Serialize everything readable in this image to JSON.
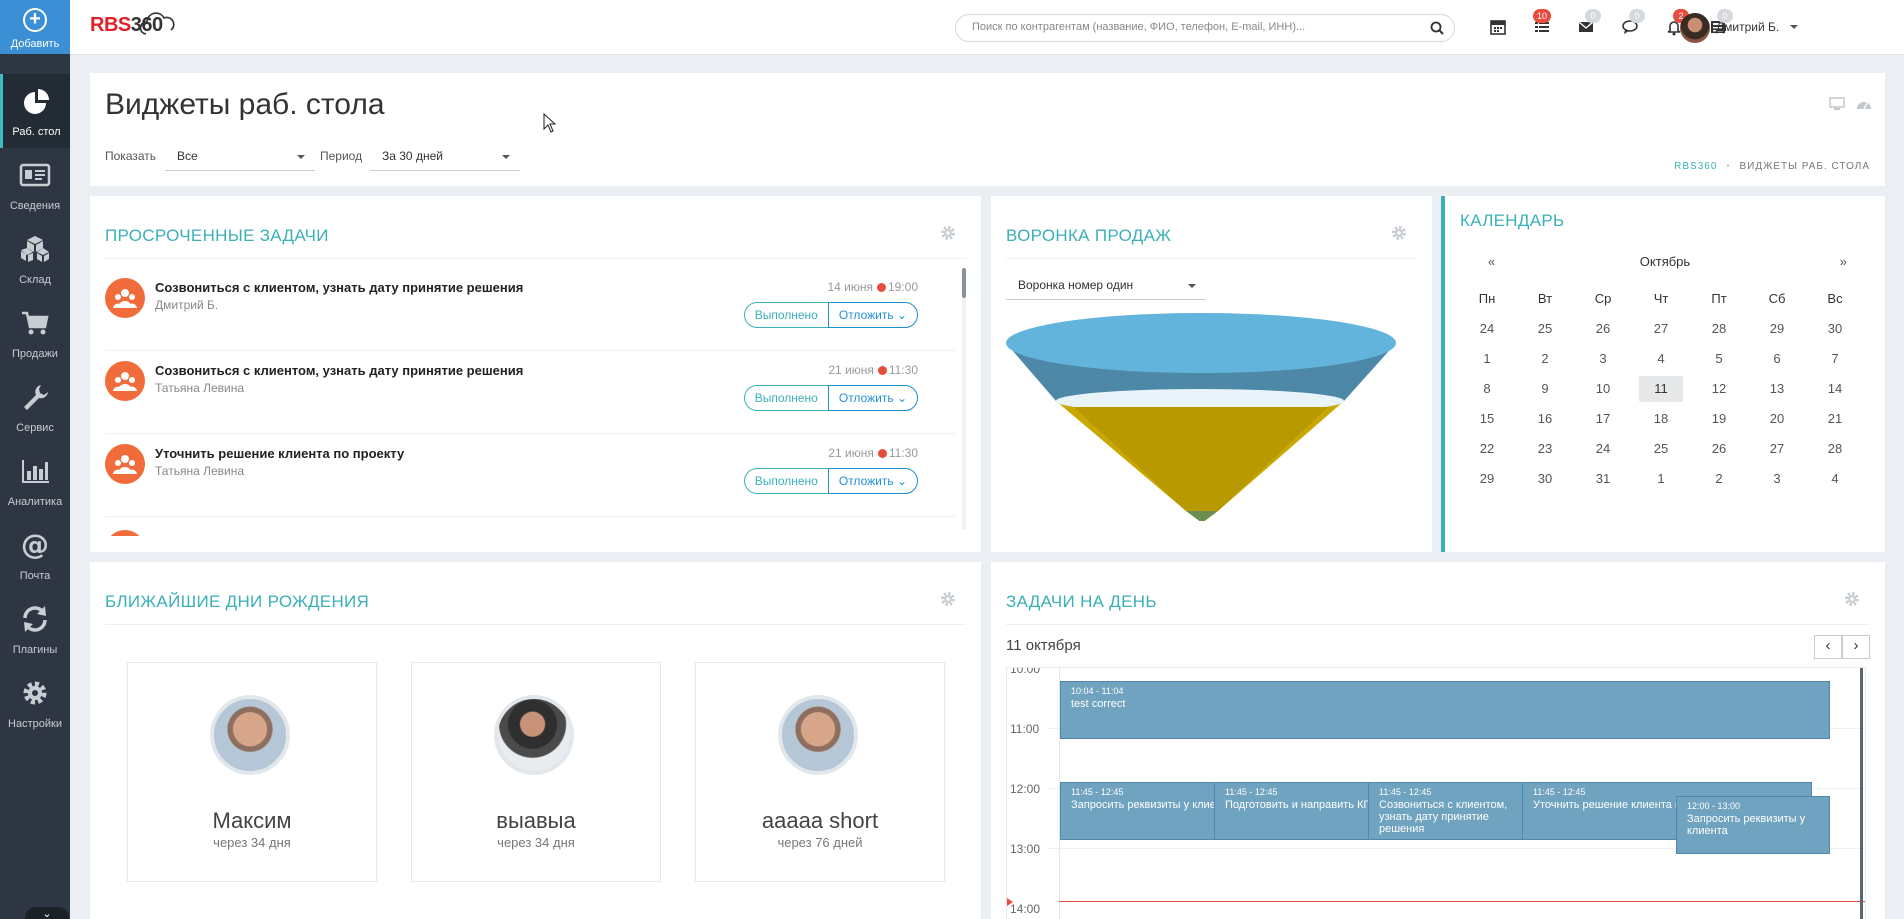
{
  "sidebar": {
    "add_label": "Добавить",
    "items": [
      {
        "label": "Раб. стол",
        "icon": "pie-chart-icon"
      },
      {
        "label": "Сведения",
        "icon": "id-card-icon"
      },
      {
        "label": "Склад",
        "icon": "boxes-icon"
      },
      {
        "label": "Продажи",
        "icon": "cart-icon"
      },
      {
        "label": "Сервис",
        "icon": "wrench-icon"
      },
      {
        "label": "Аналитика",
        "icon": "bar-chart-icon"
      },
      {
        "label": "Почта",
        "icon": "at-icon"
      },
      {
        "label": "Плагины",
        "icon": "refresh-icon"
      },
      {
        "label": "Настройки",
        "icon": "gear-icon"
      }
    ]
  },
  "topbar": {
    "logo_rbs": "RBS",
    "logo_num": "360",
    "search_placeholder": "Поиск по контрагентам (название, ФИО, телефон, E-mail, ИНН)...",
    "badges": {
      "tasks": "10",
      "mail": "0",
      "chat": "0",
      "notifications": "2",
      "other": "0"
    },
    "user_name": "Дмитрий Б.",
    "accent": "#3bb0b8",
    "badge_red": "#e74c3c"
  },
  "header": {
    "title": "Виджеты раб. стола",
    "show_label": "Показать",
    "show_value": "Все",
    "period_label": "Период",
    "period_value": "За 30 дней",
    "breadcrumb_root": "RBS360",
    "breadcrumb_sep": "•",
    "breadcrumb_current": "Виджеты раб. стола"
  },
  "overdue": {
    "title": "Просроченные задачи",
    "done_label": "Выполнено",
    "defer_label": "Отложить",
    "tasks": [
      {
        "title": "Созвониться с клиентом, узнать дату принятие решения",
        "person": "Дмитрий Б.",
        "date": "14 июня",
        "time": "19:00"
      },
      {
        "title": "Созвониться с клиентом, узнать дату принятие решения",
        "person": "Татьяна Левина",
        "date": "21 июня",
        "time": "11:30"
      },
      {
        "title": "Уточнить решение клиента по проекту",
        "person": "Татьяна Левина",
        "date": "21 июня",
        "time": "11:30"
      }
    ]
  },
  "funnel": {
    "title": "Воронка продаж",
    "select_value": "Воронка номер один",
    "colors": [
      "#5aafd8",
      "#d4b000",
      "#6b8e4e"
    ]
  },
  "calendar": {
    "title": "Календарь",
    "prev": "«",
    "next": "»",
    "month": "Октябрь",
    "weekdays": [
      "Пн",
      "Вт",
      "Ср",
      "Чт",
      "Пт",
      "Сб",
      "Вс"
    ],
    "weeks": [
      [
        "24",
        "25",
        "26",
        "27",
        "28",
        "29",
        "30"
      ],
      [
        "1",
        "2",
        "3",
        "4",
        "5",
        "6",
        "7"
      ],
      [
        "8",
        "9",
        "10",
        "11",
        "12",
        "13",
        "14"
      ],
      [
        "15",
        "16",
        "17",
        "18",
        "19",
        "20",
        "21"
      ],
      [
        "22",
        "23",
        "24",
        "25",
        "26",
        "27",
        "28"
      ],
      [
        "29",
        "30",
        "31",
        "1",
        "2",
        "3",
        "4"
      ]
    ],
    "today": "11"
  },
  "birthdays": {
    "title": "Ближайшие дни рождения",
    "people": [
      {
        "name": "Максим",
        "when": "через 34 дня"
      },
      {
        "name": "выавыа",
        "when": "через 34 дня"
      },
      {
        "name": "aaaaa short",
        "when": "через 76 дней"
      }
    ]
  },
  "day_tasks": {
    "title": "Задачи на день",
    "date": "11 октября",
    "prev": "‹",
    "next": "›",
    "times": [
      "10:00",
      "11:00",
      "12:00",
      "13:00",
      "14:00"
    ],
    "events": [
      {
        "time": "10:04 - 11:04",
        "title": "test correct"
      },
      {
        "time": "11:45 - 12:45",
        "title": "Запросить реквизиты у клиента"
      },
      {
        "time": "11:45 - 12:45",
        "title": "Подготовить и направить КП"
      },
      {
        "time": "11:45 - 12:45",
        "title": "Созвониться с клиентом, узнать дату принятие решения"
      },
      {
        "time": "11:45 - 12:45",
        "title": "Уточнить решение клиента по проекту"
      },
      {
        "time": "12:00 - 13:00",
        "title": "Запросить реквизиты у клиента"
      }
    ],
    "bottom_tab": "..."
  }
}
